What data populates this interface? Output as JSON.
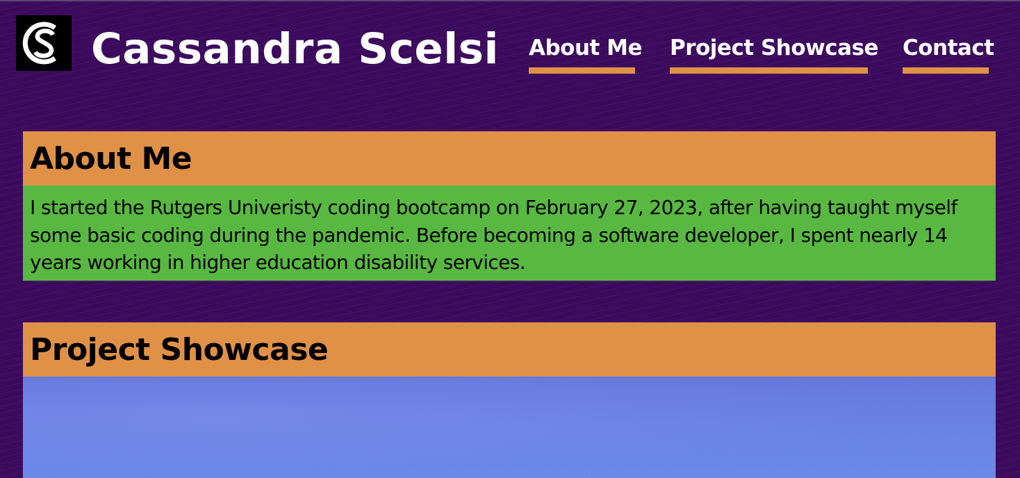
{
  "header": {
    "logo_letters": "CS",
    "site_title": "Cassandra Scelsi"
  },
  "nav": {
    "items": [
      {
        "label": "About Me"
      },
      {
        "label": "Project Showcase"
      },
      {
        "label": "Contact"
      }
    ]
  },
  "about": {
    "heading": "About Me",
    "body": "I started the Rutgers Univeristy coding bootcamp on February 27, 2023, after having taught myself some basic coding during the pandemic. Before becoming a software developer, I spent nearly 14 years working in higher education disability services."
  },
  "projects": {
    "heading": "Project Showcase"
  },
  "colors": {
    "background": "#3c0b5e",
    "accent_orange": "#e09148",
    "body_green": "#59b842",
    "project_blue": "#6782e3",
    "text_white": "#ffffff"
  }
}
